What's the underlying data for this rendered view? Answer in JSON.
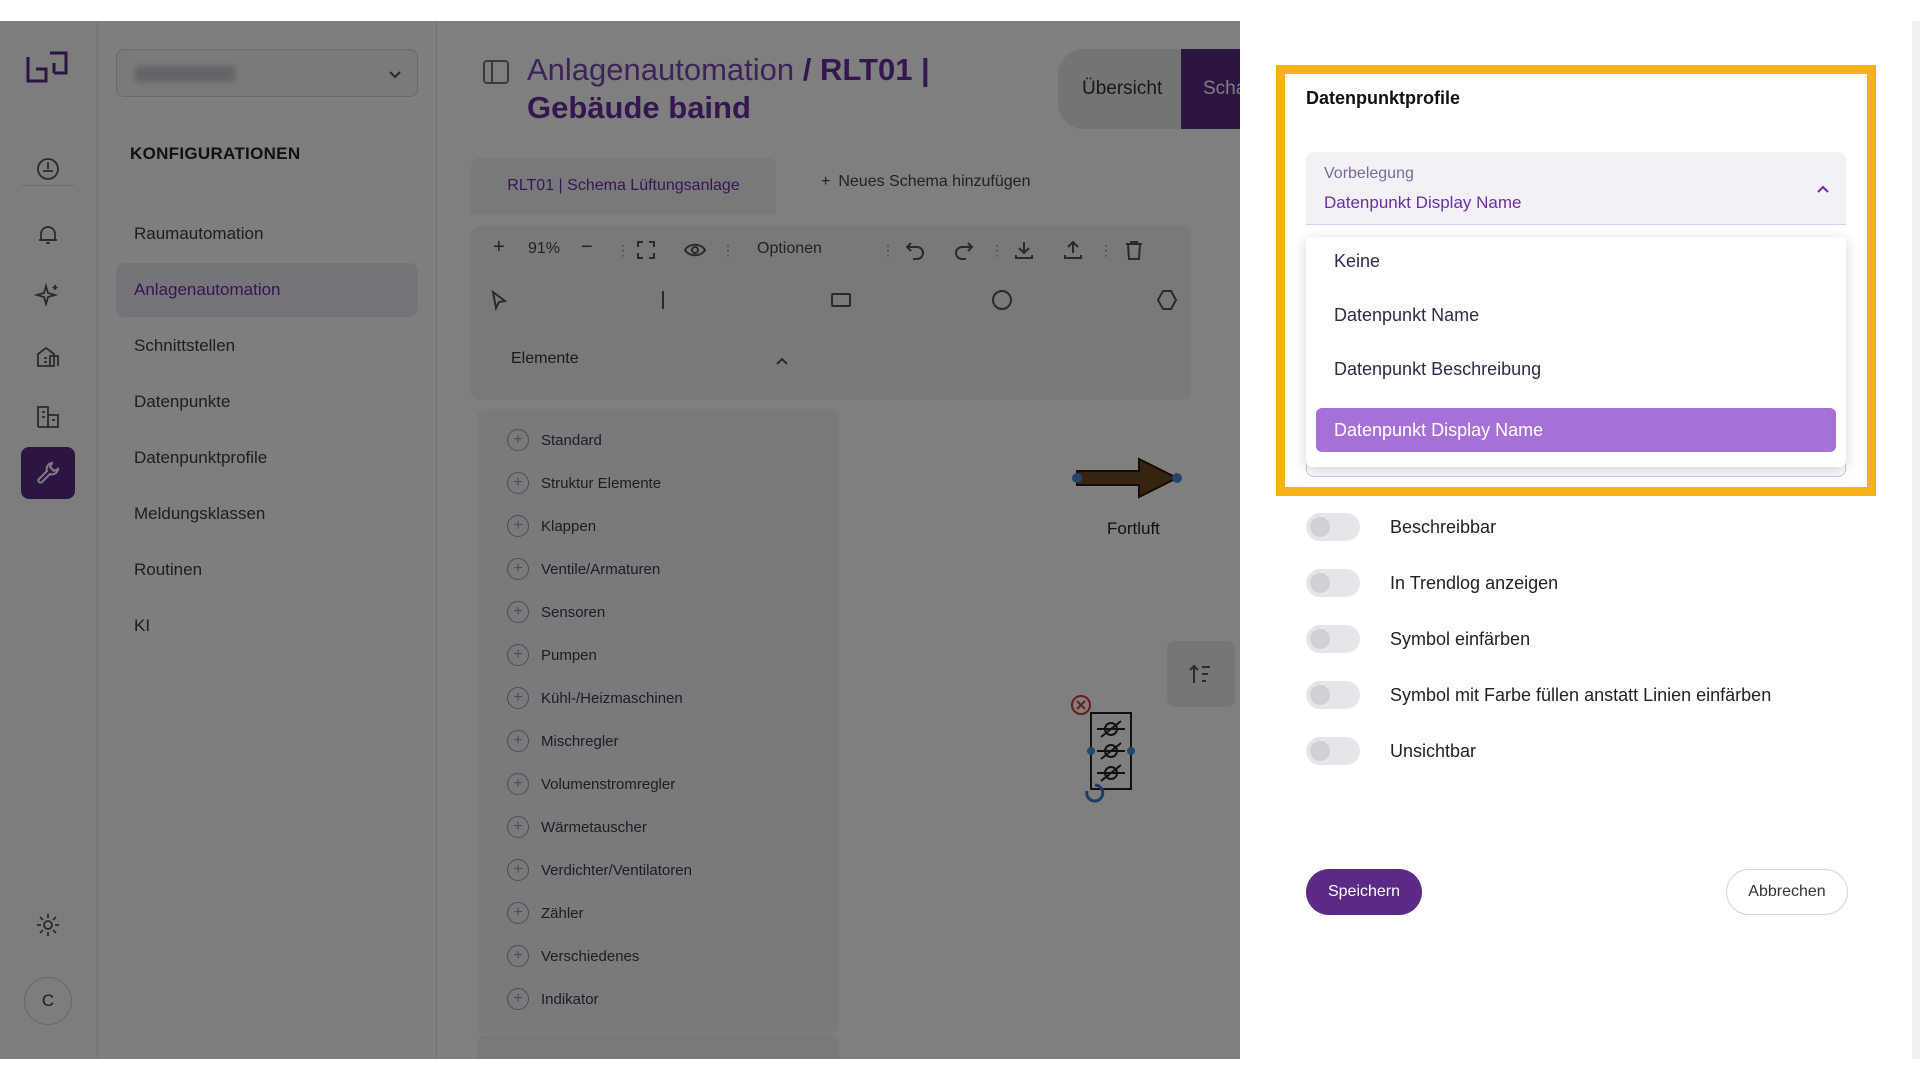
{
  "rail": {
    "icons": [
      "logo-icon",
      "dashboard-icon",
      "bell-icon",
      "sparkles-icon",
      "building-icon",
      "buildings-icon",
      "wrench-icon",
      "gear-icon"
    ],
    "avatar_initial": "C",
    "accent": "#5a2a86"
  },
  "sidebar": {
    "heading": "KONFIGURATIONEN",
    "items": [
      {
        "label": "Raumautomation"
      },
      {
        "label": "Anlagenautomation"
      },
      {
        "label": "Schnittstellen"
      },
      {
        "label": "Datenpunkte"
      },
      {
        "label": "Datenpunktprofile"
      },
      {
        "label": "Meldungsklassen"
      },
      {
        "label": "Routinen"
      },
      {
        "label": "KI"
      }
    ],
    "active_index": 1
  },
  "main": {
    "title_part1": "Anlagenautomation",
    "title_sep": " / ",
    "title_part2": "RLT01 | Gebäude baind",
    "tab_overview": "Übersicht",
    "tab_schema": "Scha",
    "schema_tab": "RLT01 | Schema Lüftungsanlage",
    "add_schema": "Neues Schema hinzufügen",
    "toolbar": {
      "zoom": "91%",
      "options": "Optionen"
    },
    "elements_heading": "Elemente",
    "element_categories": [
      "Standard",
      "Struktur Elemente",
      "Klappen",
      "Ventile/Armaturen",
      "Sensoren",
      "Pumpen",
      "Kühl-/Heizmaschinen",
      "Mischregler",
      "Volumenstromregler",
      "Wärmetauscher",
      "Verdichter/Ventilatoren",
      "Zähler",
      "Verschiedenes",
      "Indikator"
    ],
    "canvas_label": "Fortluft"
  },
  "drawer": {
    "title": "Datenpunktprofile",
    "select_label": "Vorbelegung",
    "select_value": "Datenpunkt Display Name",
    "options": [
      "Keine",
      "Datenpunkt Name",
      "Datenpunkt Beschreibung",
      "Datenpunkt Display Name"
    ],
    "selected_index": 3,
    "toggles": [
      {
        "label": "Beschreibbar",
        "on": false
      },
      {
        "label": "In Trendlog anzeigen",
        "on": false
      },
      {
        "label": "Symbol einfärben",
        "on": false
      },
      {
        "label": "Symbol mit Farbe füllen anstatt Linien einfärben",
        "on": false
      },
      {
        "label": "Unsichtbar",
        "on": false
      }
    ],
    "save_label": "Speichern",
    "cancel_label": "Abbrechen",
    "highlight_color": "#f7b21a",
    "selected_color": "#a770d6"
  }
}
